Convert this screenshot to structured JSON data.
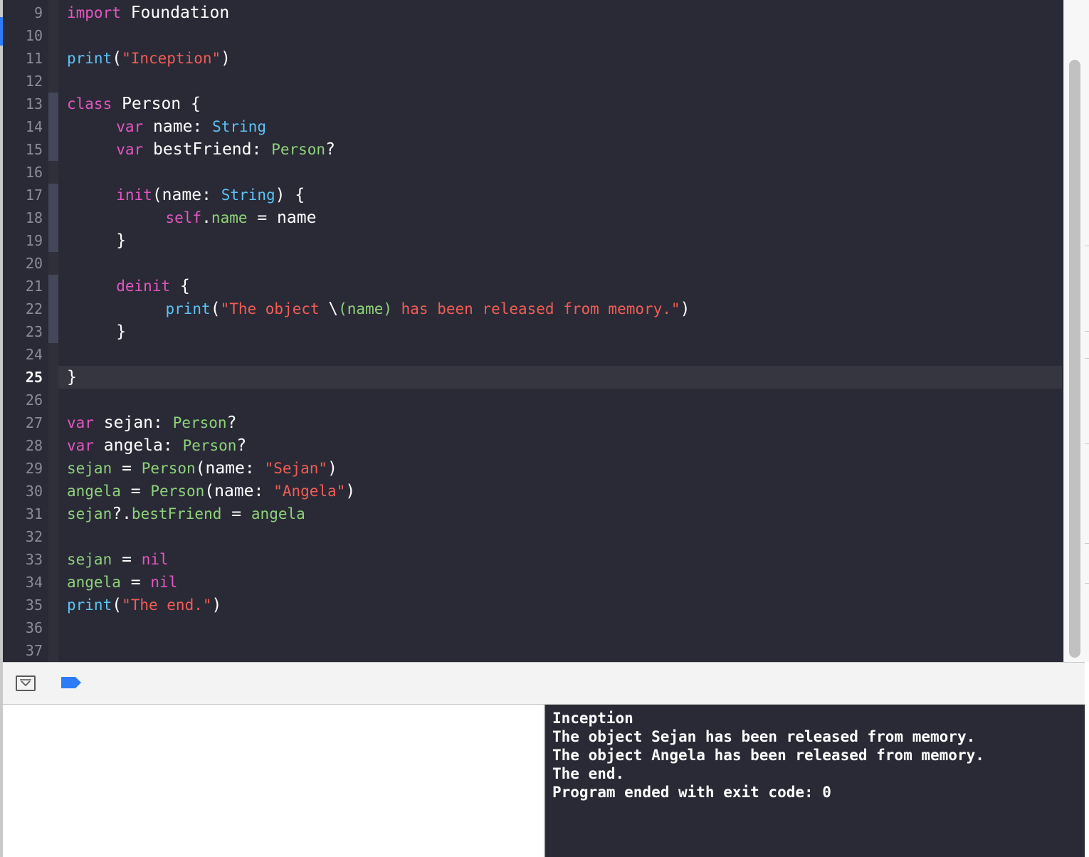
{
  "editor": {
    "current_line": 25,
    "line_numbers": [
      "9",
      "10",
      "11",
      "12",
      "13",
      "14",
      "15",
      "16",
      "17",
      "18",
      "19",
      "20",
      "21",
      "22",
      "23",
      "24",
      "25",
      "26",
      "27",
      "28",
      "29",
      "30",
      "31",
      "32",
      "33",
      "34",
      "35",
      "36",
      "37"
    ],
    "lines": [
      {
        "num": "9",
        "tokens": [
          {
            "c": "kw",
            "t": "import"
          },
          {
            "c": "pl",
            "t": " Foundation"
          }
        ]
      },
      {
        "num": "10",
        "tokens": []
      },
      {
        "num": "11",
        "tokens": [
          {
            "c": "fn",
            "t": "print"
          },
          {
            "c": "pl",
            "t": "("
          },
          {
            "c": "str",
            "t": "\"Inception\""
          },
          {
            "c": "pl",
            "t": ")"
          }
        ]
      },
      {
        "num": "12",
        "tokens": []
      },
      {
        "num": "13",
        "tokens": [
          {
            "c": "kw",
            "t": "class"
          },
          {
            "c": "pl",
            "t": " Person {"
          }
        ]
      },
      {
        "num": "14",
        "tokens": [
          {
            "c": "pl",
            "t": "     "
          },
          {
            "c": "kw",
            "t": "var"
          },
          {
            "c": "pl",
            "t": " name: "
          },
          {
            "c": "fn",
            "t": "String"
          }
        ]
      },
      {
        "num": "15",
        "tokens": [
          {
            "c": "pl",
            "t": "     "
          },
          {
            "c": "kw",
            "t": "var"
          },
          {
            "c": "pl",
            "t": " bestFriend: "
          },
          {
            "c": "ty",
            "t": "Person"
          },
          {
            "c": "pl",
            "t": "?"
          }
        ]
      },
      {
        "num": "16",
        "tokens": []
      },
      {
        "num": "17",
        "tokens": [
          {
            "c": "pl",
            "t": "     "
          },
          {
            "c": "kw",
            "t": "init"
          },
          {
            "c": "pl",
            "t": "(name: "
          },
          {
            "c": "fn",
            "t": "String"
          },
          {
            "c": "pl",
            "t": ") {"
          }
        ]
      },
      {
        "num": "18",
        "tokens": [
          {
            "c": "pl",
            "t": "          "
          },
          {
            "c": "kw",
            "t": "self"
          },
          {
            "c": "pl",
            "t": "."
          },
          {
            "c": "ty",
            "t": "name"
          },
          {
            "c": "pl",
            "t": " = name"
          }
        ]
      },
      {
        "num": "19",
        "tokens": [
          {
            "c": "pl",
            "t": "     }"
          }
        ]
      },
      {
        "num": "20",
        "tokens": []
      },
      {
        "num": "21",
        "tokens": [
          {
            "c": "pl",
            "t": "     "
          },
          {
            "c": "kw",
            "t": "deinit"
          },
          {
            "c": "pl",
            "t": " {"
          }
        ]
      },
      {
        "num": "22",
        "tokens": [
          {
            "c": "pl",
            "t": "          "
          },
          {
            "c": "fn",
            "t": "print"
          },
          {
            "c": "pl",
            "t": "("
          },
          {
            "c": "str",
            "t": "\"The object "
          },
          {
            "c": "pl",
            "t": "\\"
          },
          {
            "c": "ty",
            "t": "(name)"
          },
          {
            "c": "str",
            "t": " has been released from memory.\""
          },
          {
            "c": "pl",
            "t": ")"
          }
        ]
      },
      {
        "num": "23",
        "tokens": [
          {
            "c": "pl",
            "t": "     }"
          }
        ]
      },
      {
        "num": "24",
        "tokens": []
      },
      {
        "num": "25",
        "tokens": [
          {
            "c": "pl",
            "t": "}"
          }
        ]
      },
      {
        "num": "26",
        "tokens": []
      },
      {
        "num": "27",
        "tokens": [
          {
            "c": "kw",
            "t": "var"
          },
          {
            "c": "pl",
            "t": " sejan: "
          },
          {
            "c": "ty",
            "t": "Person"
          },
          {
            "c": "pl",
            "t": "?"
          }
        ]
      },
      {
        "num": "28",
        "tokens": [
          {
            "c": "kw",
            "t": "var"
          },
          {
            "c": "pl",
            "t": " angela: "
          },
          {
            "c": "ty",
            "t": "Person"
          },
          {
            "c": "pl",
            "t": "?"
          }
        ]
      },
      {
        "num": "29",
        "tokens": [
          {
            "c": "ty",
            "t": "sejan"
          },
          {
            "c": "pl",
            "t": " = "
          },
          {
            "c": "ty",
            "t": "Person"
          },
          {
            "c": "pl",
            "t": "(name: "
          },
          {
            "c": "str",
            "t": "\"Sejan\""
          },
          {
            "c": "pl",
            "t": ")"
          }
        ]
      },
      {
        "num": "30",
        "tokens": [
          {
            "c": "ty",
            "t": "angela"
          },
          {
            "c": "pl",
            "t": " = "
          },
          {
            "c": "ty",
            "t": "Person"
          },
          {
            "c": "pl",
            "t": "(name: "
          },
          {
            "c": "str",
            "t": "\"Angela\""
          },
          {
            "c": "pl",
            "t": ")"
          }
        ]
      },
      {
        "num": "31",
        "tokens": [
          {
            "c": "ty",
            "t": "sejan"
          },
          {
            "c": "pl",
            "t": "?."
          },
          {
            "c": "ty",
            "t": "bestFriend"
          },
          {
            "c": "pl",
            "t": " = "
          },
          {
            "c": "ty",
            "t": "angela"
          }
        ]
      },
      {
        "num": "32",
        "tokens": []
      },
      {
        "num": "33",
        "tokens": [
          {
            "c": "ty",
            "t": "sejan"
          },
          {
            "c": "pl",
            "t": " = "
          },
          {
            "c": "kw",
            "t": "nil"
          }
        ]
      },
      {
        "num": "34",
        "tokens": [
          {
            "c": "ty",
            "t": "angela"
          },
          {
            "c": "pl",
            "t": " = "
          },
          {
            "c": "kw",
            "t": "nil"
          }
        ]
      },
      {
        "num": "35",
        "tokens": [
          {
            "c": "fn",
            "t": "print"
          },
          {
            "c": "pl",
            "t": "("
          },
          {
            "c": "str",
            "t": "\"The end.\""
          },
          {
            "c": "pl",
            "t": ")"
          }
        ]
      },
      {
        "num": "36",
        "tokens": []
      },
      {
        "num": "37",
        "tokens": []
      }
    ]
  },
  "debug_bar": {
    "toggle_icon": "hide-debug-area-icon",
    "breakpoint_icon": "breakpoint-icon",
    "breakpoint_color": "#2d7cf6"
  },
  "console": {
    "lines": [
      "Inception",
      "The object Sejan has been released from memory.",
      "The object Angela has been released from memory.",
      "The end.",
      "Program ended with exit code: 0"
    ]
  },
  "colors": {
    "editor_bg": "#292a36",
    "keyword": "#e457c0",
    "function": "#5dc3f5",
    "string": "#f25d55",
    "type": "#8fd27a",
    "plain": "#ffffff"
  }
}
